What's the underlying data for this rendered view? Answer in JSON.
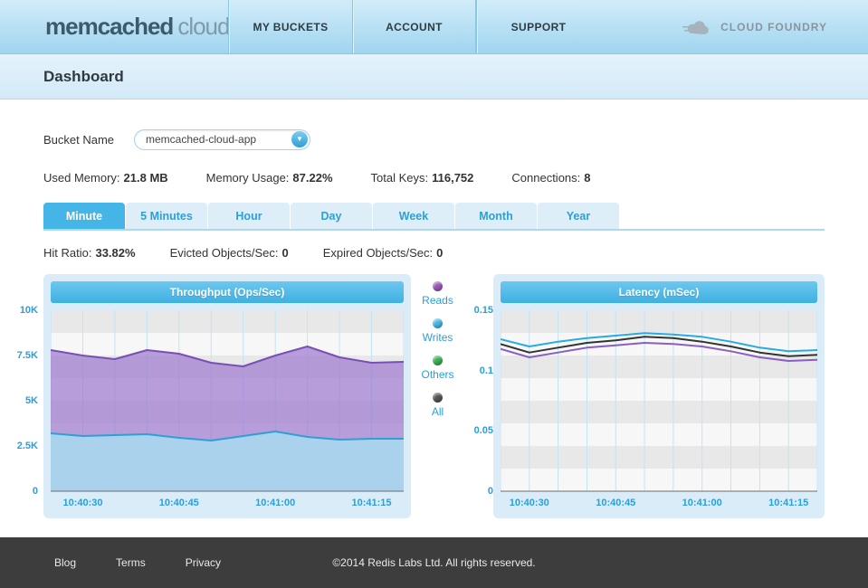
{
  "header": {
    "logo_primary": "memcached",
    "logo_secondary": "cloud",
    "nav": [
      {
        "label": "MY BUCKETS"
      },
      {
        "label": "ACCOUNT"
      },
      {
        "label": "SUPPORT"
      }
    ],
    "partner_logo": "CLOUD FOUNDRY"
  },
  "page": {
    "title": "Dashboard"
  },
  "bucket": {
    "label": "Bucket Name",
    "selected": "memcached-cloud-app"
  },
  "stats": [
    {
      "label": "Used Memory:",
      "value": "21.8 MB"
    },
    {
      "label": "Memory Usage:",
      "value": "87.22%"
    },
    {
      "label": "Total Keys:",
      "value": "116,752"
    },
    {
      "label": "Connections:",
      "value": "8"
    }
  ],
  "tabs": [
    {
      "label": "Minute",
      "active": true
    },
    {
      "label": "5 Minutes",
      "active": false
    },
    {
      "label": "Hour",
      "active": false
    },
    {
      "label": "Day",
      "active": false
    },
    {
      "label": "Week",
      "active": false
    },
    {
      "label": "Month",
      "active": false
    },
    {
      "label": "Year",
      "active": false
    }
  ],
  "substats": [
    {
      "label": "Hit Ratio:",
      "value": "33.82%"
    },
    {
      "label": "Evicted Objects/Sec:",
      "value": "0"
    },
    {
      "label": "Expired Objects/Sec:",
      "value": "0"
    }
  ],
  "legend": [
    {
      "label": "Reads",
      "color": "#9b59b6"
    },
    {
      "label": "Writes",
      "color": "#45b8e8"
    },
    {
      "label": "Others",
      "color": "#3fae53"
    },
    {
      "label": "All",
      "color": "#555555"
    }
  ],
  "chart_data": [
    {
      "type": "area",
      "title": "Throughput (Ops/Sec)",
      "ylabel": "Ops/Sec",
      "ylim": [
        0,
        10000
      ],
      "y_ticks": [
        "10K",
        "7.5K",
        "5K",
        "2.5K",
        "0"
      ],
      "x_ticks": [
        "10:40:30",
        "10:40:45",
        "10:41:00",
        "10:41:15"
      ],
      "x_tick_indices": [
        1,
        4,
        7,
        10
      ],
      "grid": true,
      "legend_position": "between-charts",
      "series": [
        {
          "name": "Reads",
          "color": "#7a4fb5",
          "fill": "rgba(158,122,205,0.72)",
          "values": [
            7800,
            7500,
            7300,
            7800,
            7600,
            7100,
            6900,
            7500,
            8000,
            7400,
            7100,
            7150
          ]
        },
        {
          "name": "Writes",
          "color": "#2f9fd6",
          "fill": "rgba(168,216,238,0.9)",
          "values": [
            3200,
            3050,
            3100,
            3150,
            2950,
            2800,
            3050,
            3300,
            3000,
            2850,
            2900,
            2900
          ]
        }
      ]
    },
    {
      "type": "line",
      "title": "Latency (mSec)",
      "ylabel": "mSec",
      "ylim": [
        0,
        0.15
      ],
      "y_ticks": [
        "0.15",
        "0.1",
        "0.05",
        "0"
      ],
      "x_ticks": [
        "10:40:30",
        "10:40:45",
        "10:41:00",
        "10:41:15"
      ],
      "x_tick_indices": [
        1,
        4,
        7,
        10
      ],
      "grid": true,
      "series": [
        {
          "name": "Reads",
          "color": "#8a5fc0",
          "values": [
            0.118,
            0.111,
            0.115,
            0.119,
            0.121,
            0.123,
            0.122,
            0.12,
            0.116,
            0.111,
            0.108,
            0.109
          ]
        },
        {
          "name": "All",
          "color": "#333333",
          "values": [
            0.122,
            0.115,
            0.119,
            0.123,
            0.125,
            0.128,
            0.127,
            0.124,
            0.12,
            0.115,
            0.112,
            0.113
          ]
        },
        {
          "name": "Writes",
          "color": "#29abe2",
          "values": [
            0.126,
            0.12,
            0.124,
            0.127,
            0.129,
            0.131,
            0.13,
            0.128,
            0.124,
            0.119,
            0.116,
            0.117
          ]
        }
      ]
    }
  ],
  "footer": {
    "links": [
      {
        "label": "Blog"
      },
      {
        "label": "Terms"
      },
      {
        "label": "Privacy"
      }
    ],
    "copyright": "©2014 Redis Labs Ltd. All rights reserved."
  }
}
